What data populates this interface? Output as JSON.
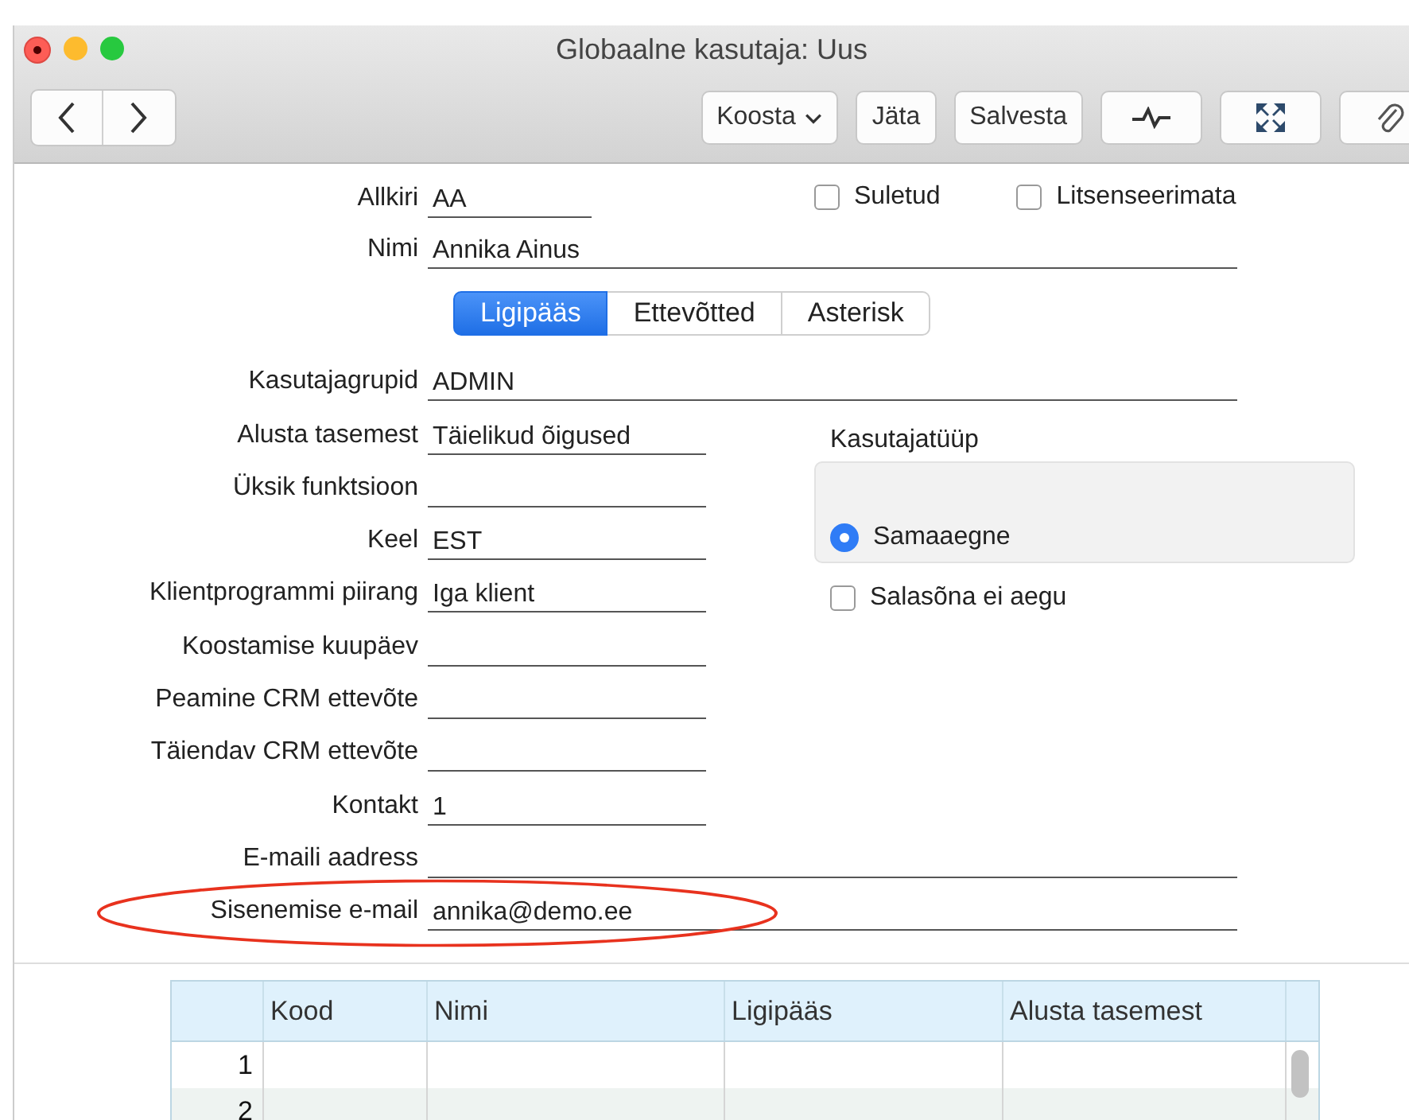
{
  "window": {
    "title": "Globaalne kasutaja: Uus"
  },
  "toolbar": {
    "buttons": [
      {
        "label": "Koosta",
        "kind": "menu"
      },
      {
        "label": "Jäta",
        "kind": "text"
      },
      {
        "label": "Salvesta",
        "kind": "text"
      },
      {
        "kind": "pulse"
      },
      {
        "kind": "expand"
      },
      {
        "kind": "clip"
      }
    ]
  },
  "header": {
    "signature": {
      "label": "Allkiri",
      "value": "AA"
    },
    "name": {
      "label": "Nimi",
      "value": "Annika Ainus"
    },
    "checkboxes": [
      {
        "label": "Suletud",
        "checked": false
      },
      {
        "label": "Litsenseerimata",
        "checked": false
      }
    ]
  },
  "tabs": [
    {
      "label": "Ligipääs",
      "selected": true
    },
    {
      "label": "Ettevõtted",
      "selected": false
    },
    {
      "label": "Asterisk",
      "selected": false
    }
  ],
  "fields": [
    {
      "label": "Kasutajagrupid",
      "value": "ADMIN",
      "kind": "long"
    },
    {
      "label": "Alusta tasemest",
      "value": "Täielikud õigused",
      "kind": "short"
    },
    {
      "label": "Üksik funktsioon",
      "kind": "short"
    },
    {
      "label": "Keel",
      "value": "EST",
      "kind": "short"
    },
    {
      "label": "Klientprogrammi piirang",
      "value": "Iga klient",
      "kind": "short"
    },
    {
      "label": "Koostamise kuupäev",
      "kind": "short"
    },
    {
      "label": "Peamine CRM ettevõte",
      "kind": "short"
    },
    {
      "label": "Täiendav CRM ettevõte",
      "kind": "short"
    },
    {
      "label": "Kontakt",
      "value": "1",
      "kind": "short"
    },
    {
      "label": "E-maili aadress",
      "kind": "long"
    },
    {
      "label": "Sisenemise e-mail",
      "value": "annika@demo.ee",
      "kind": "long",
      "highlighted": true
    }
  ],
  "user_type": {
    "title": "Kasutajatüüp",
    "options": [
      {
        "label": "Samaaegne",
        "selected": true
      }
    ],
    "checkbox": {
      "label": "Salasõna ei aegu",
      "checked": false
    }
  },
  "table": {
    "columns": [
      "Kood",
      "Nimi",
      "Ligipääs",
      "Alusta tasemest"
    ],
    "rows": [
      {
        "number": "1"
      },
      {
        "number": "2"
      }
    ]
  }
}
